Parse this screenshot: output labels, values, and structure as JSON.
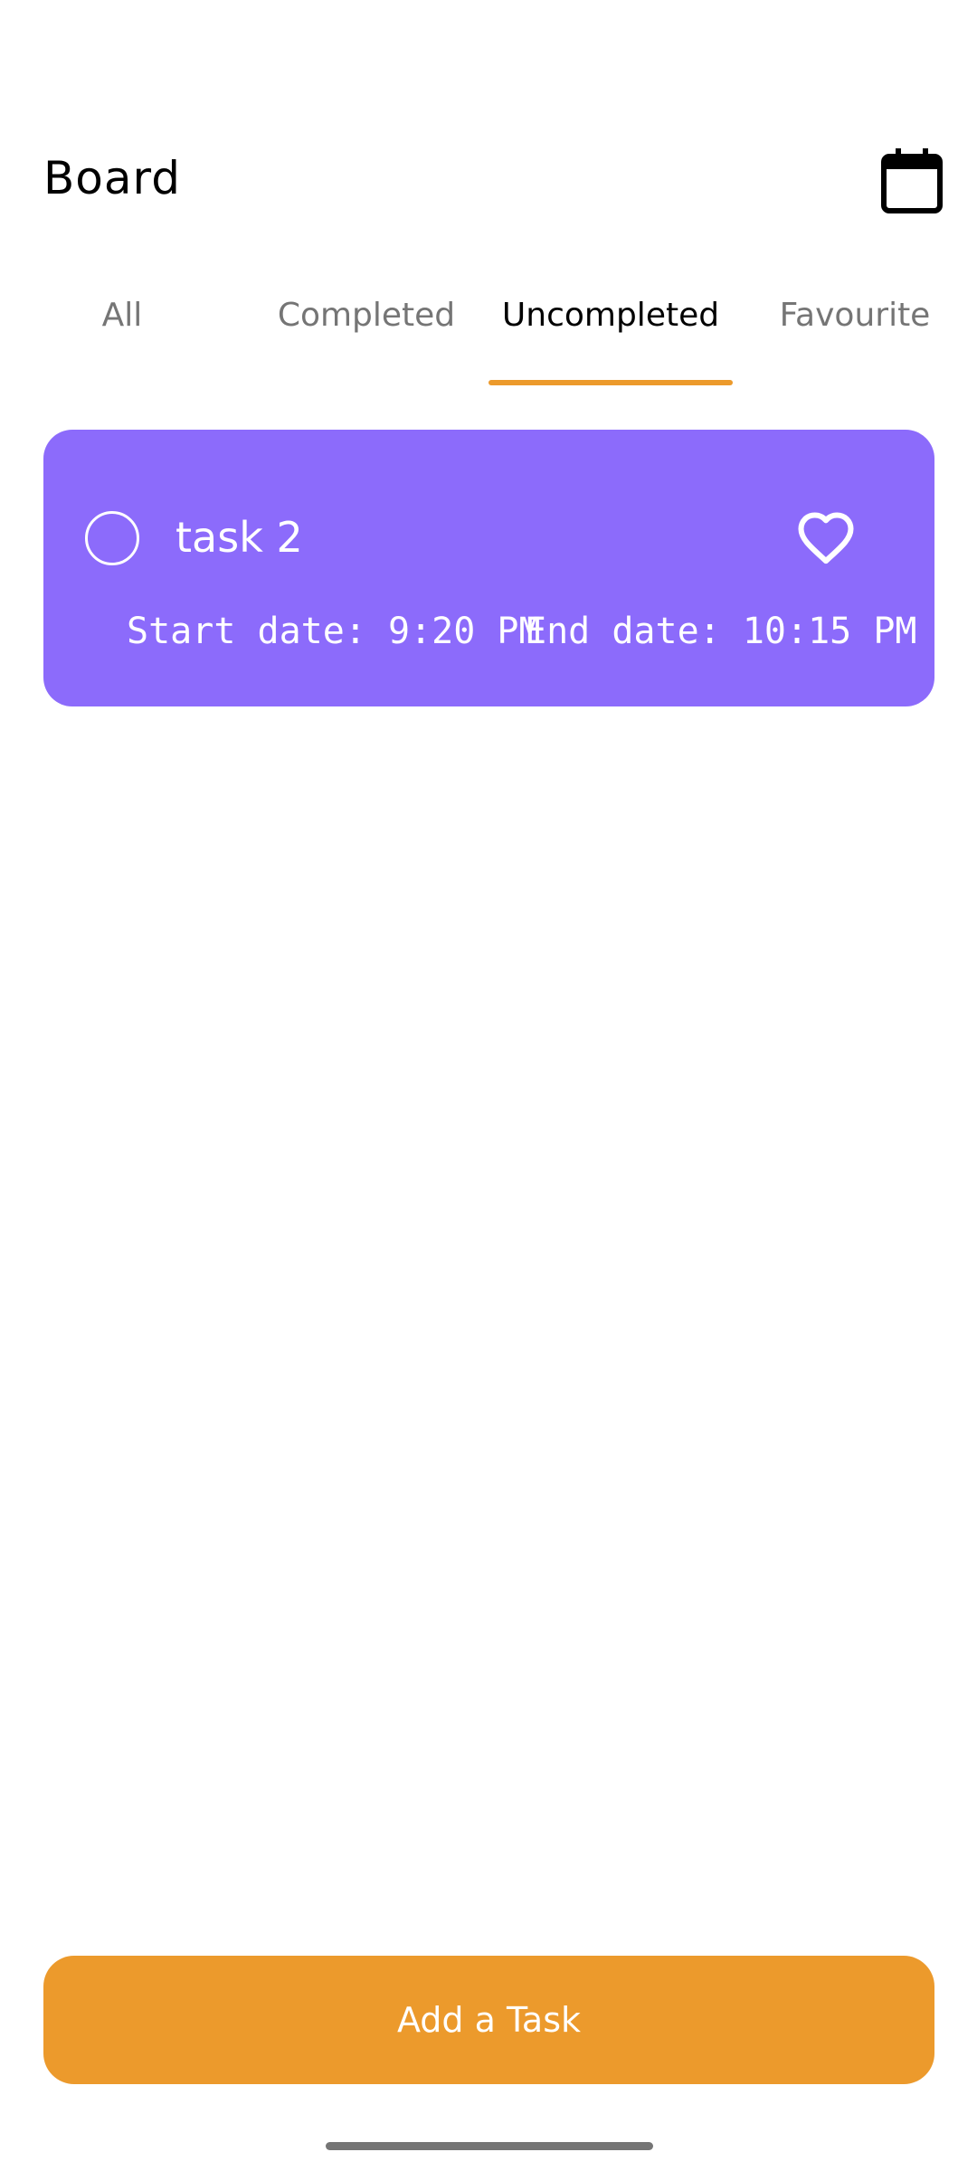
{
  "header": {
    "title": "Board",
    "calendar_icon": "calendar-icon"
  },
  "tabs": [
    {
      "label": "All",
      "active": false
    },
    {
      "label": "Completed",
      "active": false
    },
    {
      "label": "Uncompleted",
      "active": true
    },
    {
      "label": "Favourite",
      "active": false
    }
  ],
  "tasks": [
    {
      "title": "task 2",
      "start": "Start date: 9:20 PM",
      "end": "End date: 10:15 PM",
      "completed": false,
      "favourite": false,
      "color": "#8C6BFB"
    }
  ],
  "actions": {
    "add_task_label": "Add a Task"
  },
  "colors": {
    "accent": "#EC9A2C",
    "task_card": "#8C6BFB",
    "tab_inactive": "#757575",
    "text_primary": "#000000"
  }
}
